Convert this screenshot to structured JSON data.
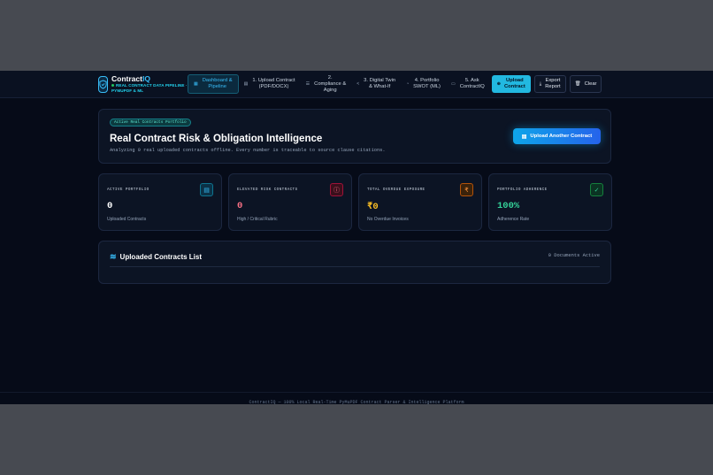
{
  "brand": {
    "name_prefix": "Contract",
    "name_accent": "IQ",
    "subtitle_line1": "REAL CONTRACT DATA PIPELINE ·",
    "subtitle_line2": "PYMUPDF & ML"
  },
  "nav": [
    {
      "label_1": "Dashboard &",
      "label_2": "Pipeline",
      "icon": "grid-icon",
      "active": true
    },
    {
      "label_1": "1. Upload Contract",
      "label_2": "(PDF/DOCX)",
      "icon": "file-icon"
    },
    {
      "label_1": "2.",
      "label_2": "Compliance &",
      "label_3": "Aging",
      "icon": "list-icon"
    },
    {
      "label_1": "3. Digital Twin",
      "label_2": "& What-If",
      "icon": "share-icon"
    },
    {
      "label_1": "4. Portfolio",
      "label_2": "SWOT (ML)",
      "icon": "gauge-icon"
    },
    {
      "label_1": "5. Ask",
      "label_2": "ContractIQ",
      "icon": "chat-icon"
    }
  ],
  "actions": {
    "upload_1": "Upload",
    "upload_2": "Contract",
    "export_1": "Export",
    "export_2": "Report",
    "clear": "Clear"
  },
  "hero": {
    "badge": "Active Real Contracts Portfolio",
    "title": "Real Contract Risk & Obligation Intelligence",
    "subtitle": "Analyzing 0 real uploaded contracts offline. Every number is traceable to source clause citations.",
    "button": "Upload Another Contract"
  },
  "kpis": [
    {
      "label": "ACTIVE PORTFOLIO",
      "value": "0",
      "note": "Uploaded Contracts",
      "color": "#ffffff",
      "icon": "document-icon"
    },
    {
      "label": "ELEVATED RISK CONTRACTS",
      "value": "0",
      "note": "High / Critical Rubric",
      "color": "#fb7185",
      "icon": "alert-icon"
    },
    {
      "label": "TOTAL OVERDUE EXPOSURE",
      "value": "₹0",
      "note": "No Overdue Invoices",
      "color": "#fbbf24",
      "icon": "rupee-icon"
    },
    {
      "label": "PORTFOLIO ADHERENCE",
      "value": "100%",
      "note": "Adherence Rate",
      "color": "#34d399",
      "icon": "check-circle-icon"
    }
  ],
  "list": {
    "title": "Uploaded Contracts List",
    "count": "0 Documents Active"
  },
  "footer": "ContractIQ — 100% Local Real-Time PyMuPDF Contract Parser & Intelligence Platform"
}
